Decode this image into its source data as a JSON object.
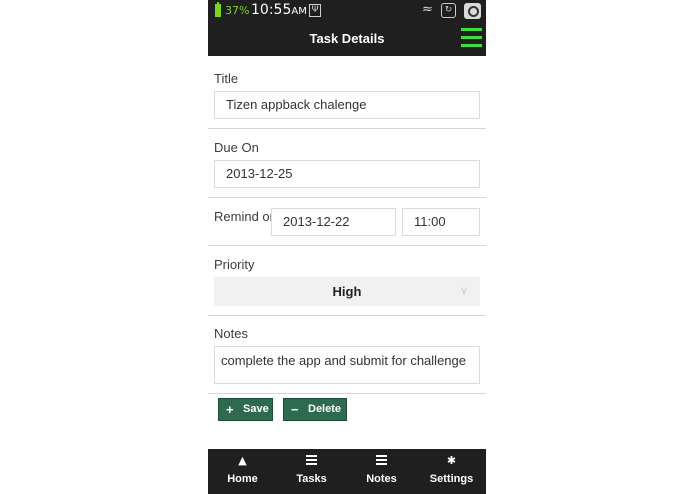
{
  "status": {
    "battery_pct": "37%",
    "time": "10:55",
    "ampm": "AM"
  },
  "header": {
    "title": "Task Details"
  },
  "form": {
    "title_label": "Title",
    "title_value": "Tizen appback chalenge",
    "due_label": "Due On",
    "due_value": "2013-12-25",
    "remind_label": "Remind on",
    "remind_date": "2013-12-22",
    "remind_time": "11:00",
    "priority_label": "Priority",
    "priority_value": "High",
    "notes_label": "Notes",
    "notes_value": "complete the app and submit for challenge"
  },
  "buttons": {
    "save": "Save",
    "delete": "Delete"
  },
  "tabs": [
    {
      "label": "Home",
      "icon": "home-icon"
    },
    {
      "label": "Tasks",
      "icon": "list-icon"
    },
    {
      "label": "Notes",
      "icon": "list-icon"
    },
    {
      "label": "Settings",
      "icon": "gear-icon"
    }
  ],
  "colors": {
    "accent": "#2d6a4f",
    "menu": "#3cdc3c",
    "bar": "#1f1f1f"
  }
}
